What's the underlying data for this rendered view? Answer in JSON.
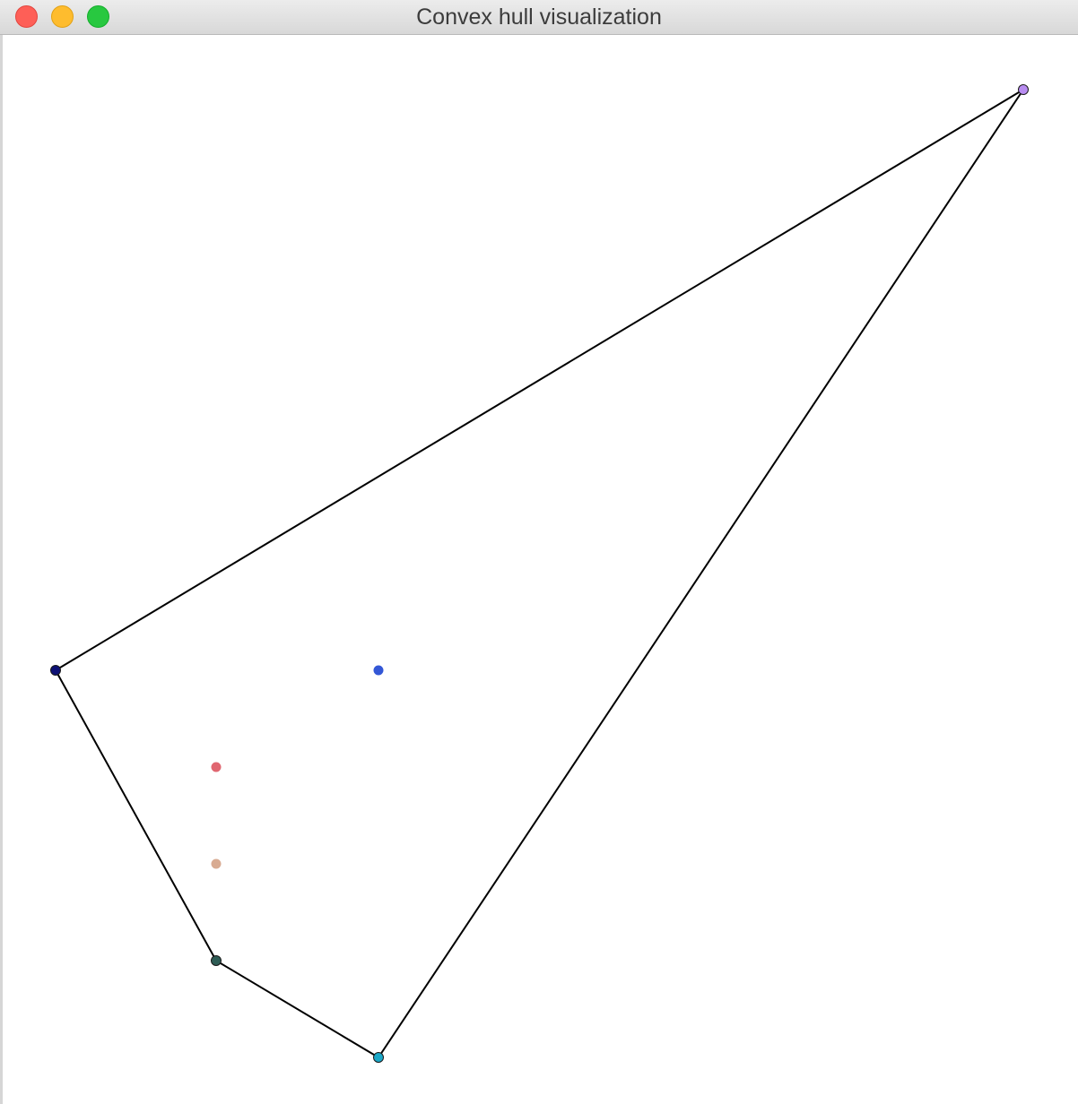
{
  "window": {
    "title": "Convex hull visualization"
  },
  "colors": {
    "hull_stroke": "#000000"
  },
  "points": [
    {
      "id": "p1",
      "color": "#b88cf0",
      "on_hull": true
    },
    {
      "id": "p2",
      "color": "#0d1075",
      "on_hull": true
    },
    {
      "id": "p3",
      "color": "#3357d6",
      "on_hull": false
    },
    {
      "id": "p4",
      "color": "#e06670",
      "on_hull": false
    },
    {
      "id": "p5",
      "color": "#d8ab92",
      "on_hull": false
    },
    {
      "id": "p6",
      "color": "#2e5c55",
      "on_hull": true
    },
    {
      "id": "p7",
      "color": "#1ba8c8",
      "on_hull": true
    }
  ],
  "hull_order": [
    "p1",
    "p2",
    "p6",
    "p7"
  ]
}
